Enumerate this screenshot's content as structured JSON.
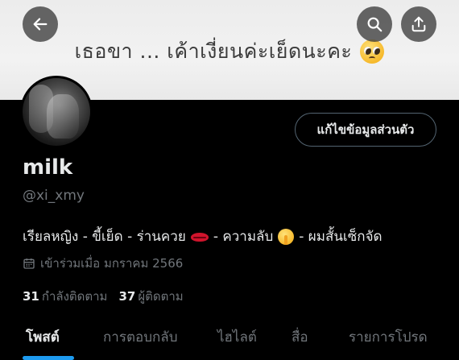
{
  "banner": {
    "text": "เธอขา ... เค้าเงี่ยนค่ะเย็ดนะคะ",
    "emoji": "pleading-face-emoji"
  },
  "profile": {
    "name": "milk",
    "handle": "@xi_xmy",
    "bio_part1": "เรียลหญิง - ขี้เย็ด - ร่านควย",
    "bio_part2": "- ความลับ",
    "bio_part3": "- ผมสั้นเซ็กจัด",
    "joined": "เข้าร่วมเมื่อ มกราคม 2566",
    "following_count": "31",
    "following_label": "กำลังติดตาม",
    "followers_count": "37",
    "followers_label": "ผู้ติดตาม"
  },
  "buttons": {
    "edit_profile": "แก้ไขข้อมูลส่วนตัว"
  },
  "tabs": [
    {
      "label": "โพสต์",
      "active": true
    },
    {
      "label": "การตอบกลับ",
      "active": false
    },
    {
      "label": "ไฮไลต์",
      "active": false
    },
    {
      "label": "สื่อ",
      "active": false
    },
    {
      "label": "รายการโปรด",
      "active": false
    }
  ],
  "icons": {
    "back": "arrow-left-icon",
    "search": "search-icon",
    "share": "share-icon",
    "calendar": "calendar-icon"
  },
  "colors": {
    "accent": "#1d9bf0",
    "background": "#000000",
    "muted": "#71767b"
  }
}
